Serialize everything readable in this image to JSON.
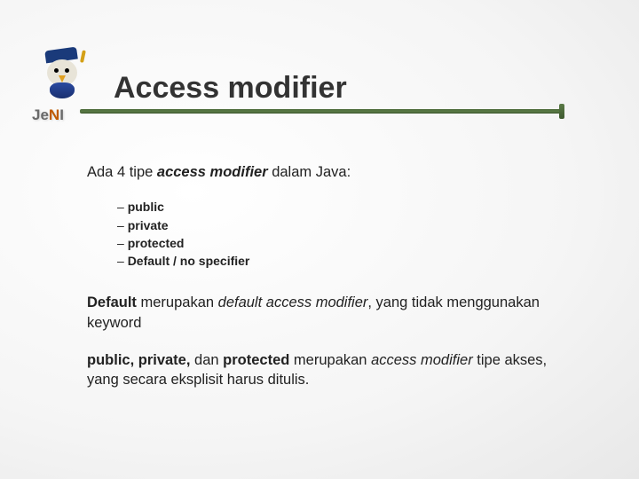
{
  "logo": {
    "brand": "JeNI",
    "brand_prefix": "Je",
    "brand_accent": "N",
    "brand_suffix": "I"
  },
  "title": "Access modifier",
  "intro": {
    "pre": "Ada 4 tipe ",
    "em": "access modifier",
    "post": " dalam Java:"
  },
  "modifiers": [
    "public",
    "private",
    "protected",
    "Default / no specifier"
  ],
  "para1": {
    "b1": "Default",
    "t1": " merupakan ",
    "i1": "default access modifier",
    "t2": ", yang tidak menggunakan keyword"
  },
  "para2": {
    "b1": "public, private, ",
    "t1": "dan ",
    "b2": "protected",
    "t2": " merupakan ",
    "i1": "access modifier",
    "t3": " tipe akses, yang secara eksplisit harus ditulis."
  }
}
